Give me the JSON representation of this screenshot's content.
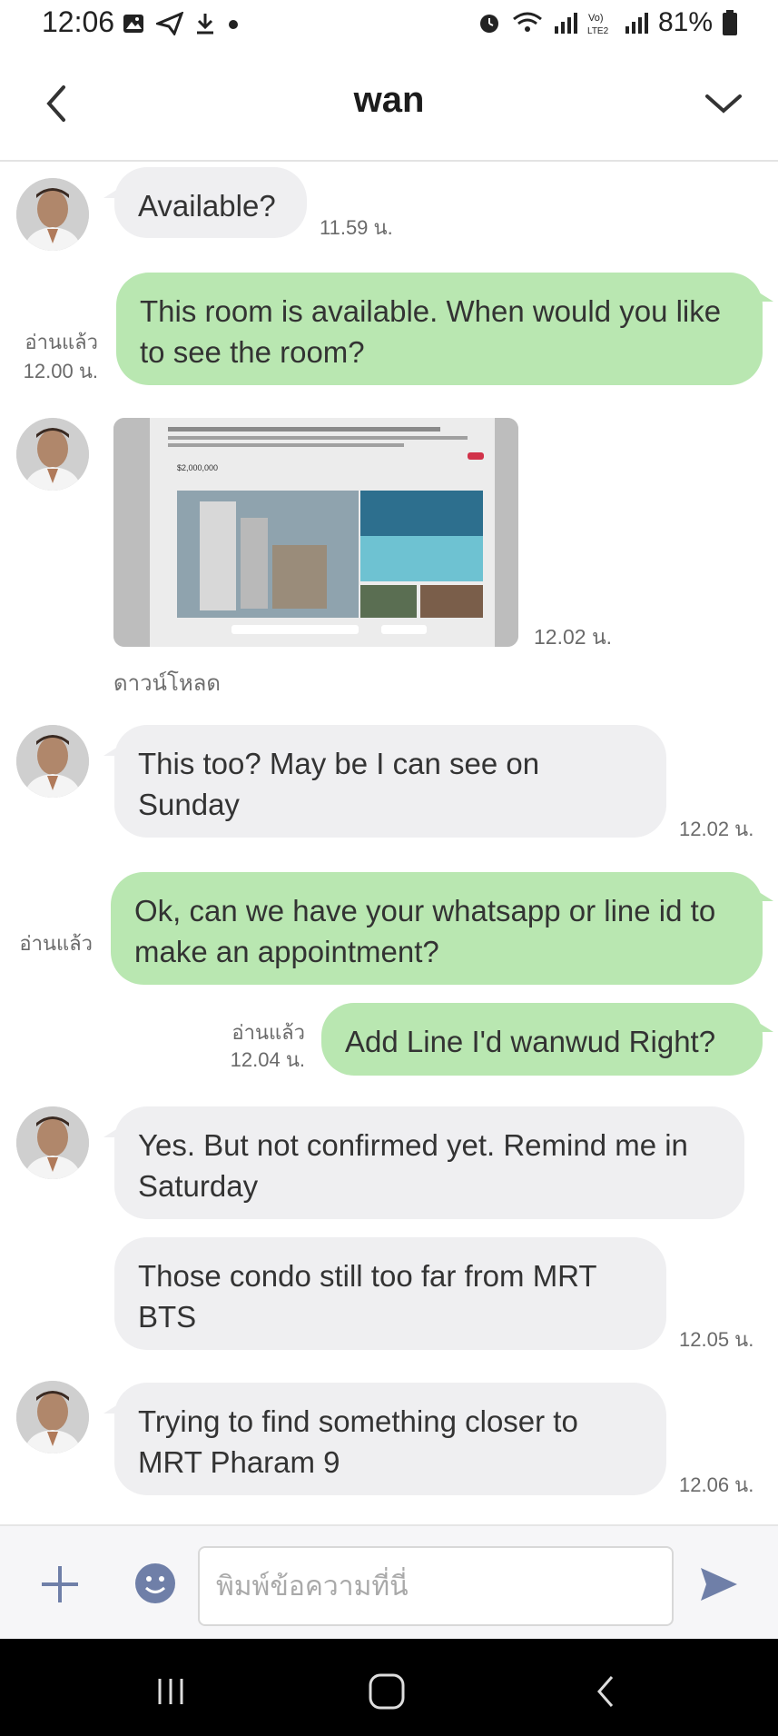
{
  "status_bar": {
    "time": "12:06",
    "battery": "81%",
    "icons_left": [
      "gallery-icon",
      "send-icon",
      "download-icon",
      "dot-icon"
    ],
    "icons_right": [
      "alarm-icon",
      "wifi-icon",
      "signal-icon",
      "volte-icon",
      "signal-icon",
      "battery-icon"
    ]
  },
  "header": {
    "title": "wan",
    "back_icon": "chevron-left-icon",
    "menu_icon": "chevron-down-icon"
  },
  "messages": [
    {
      "side": "in",
      "type": "text",
      "text": "Available?",
      "time": "11.59 น."
    },
    {
      "side": "out",
      "type": "text",
      "text": "This room is available. When would you like to see the room?",
      "read": "อ่านแล้ว",
      "time": "12.00 น."
    },
    {
      "side": "in",
      "type": "image",
      "time": "12.02 น.",
      "action": "ดาวน์โหลด",
      "image_caption": "$2,000,000"
    },
    {
      "side": "in",
      "type": "text",
      "text": "This too? May be I can see on Sunday",
      "time": "12.02 น."
    },
    {
      "side": "out",
      "type": "text",
      "text": "Ok, can we have your whatsapp or line id to make an appointment?",
      "read": "อ่านแล้ว"
    },
    {
      "side": "out",
      "type": "text",
      "text": "Add Line I'd wanwud Right?",
      "read": "อ่านแล้ว",
      "time": "12.04 น."
    },
    {
      "side": "in",
      "type": "text",
      "text": "Yes. But not confirmed yet. Remind me in Saturday"
    },
    {
      "side": "in",
      "type": "text",
      "text": "Those condo still too far from MRT BTS",
      "time": "12.05 น."
    },
    {
      "side": "in",
      "type": "text",
      "text": "Trying to find something closer to MRT Pharam 9",
      "time": "12.06 น."
    }
  ],
  "input_bar": {
    "placeholder": "พิมพ์ข้อความที่นี่",
    "plus_icon": "plus-icon",
    "emoji_icon": "emoji-icon",
    "send_icon": "send-icon"
  },
  "nav_bar": {
    "icons": [
      "recent-apps-icon",
      "home-icon",
      "back-icon"
    ]
  },
  "colors": {
    "incoming_bubble": "#efeff1",
    "outgoing_bubble": "#b9e7b1",
    "accent": "#6f7fa8"
  }
}
